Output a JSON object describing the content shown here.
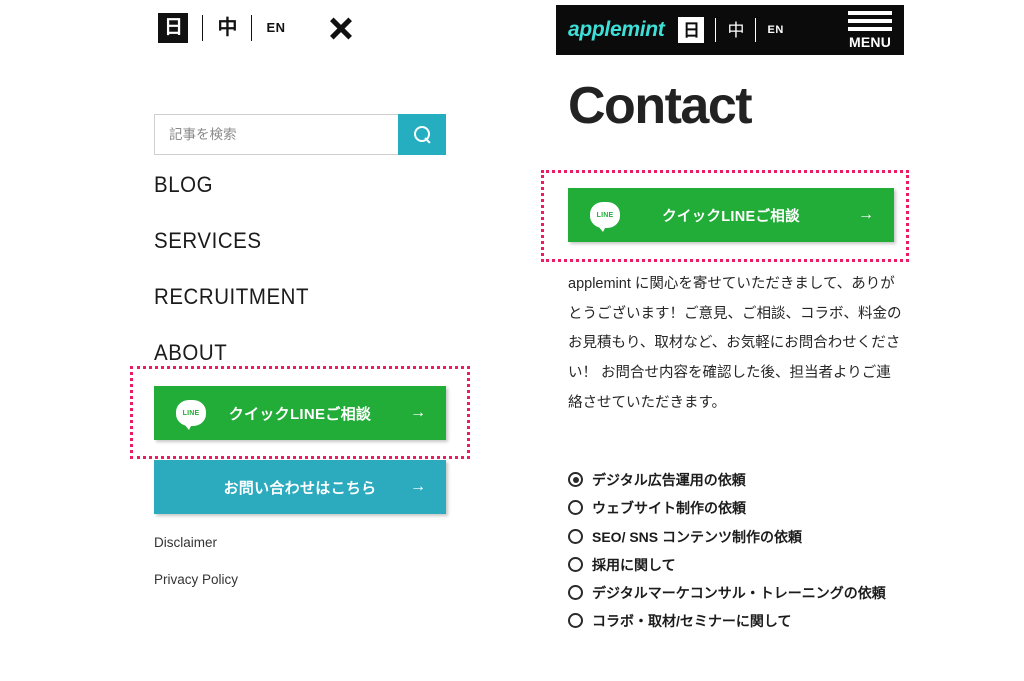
{
  "left_panel": {
    "header": {
      "lang_ja": "日",
      "lang_zh": "中",
      "lang_en": "EN",
      "close_icon": "close-icon"
    },
    "search": {
      "placeholder": "記事を検索",
      "value": "",
      "icon": "search-icon"
    },
    "nav": [
      {
        "label": "BLOG"
      },
      {
        "label": "SERVICES"
      },
      {
        "label": "RECRUITMENT"
      },
      {
        "label": "ABOUT"
      }
    ],
    "line_button": {
      "label": "クイックLINEご相談",
      "badge": "LINE",
      "arrow": "→",
      "color": "#22ac38"
    },
    "contact_button": {
      "label": "お問い合わせはこちら",
      "arrow": "→",
      "color": "#2cabbf"
    },
    "footer_links": [
      {
        "label": "Disclaimer"
      },
      {
        "label": "Privacy Policy"
      }
    ]
  },
  "right_panel": {
    "header": {
      "brand": "applemint",
      "lang_ja": "日",
      "lang_zh": "中",
      "lang_en": "EN",
      "menu_label": "MENU"
    },
    "title": "Contact",
    "line_button": {
      "label": "クイックLINEご相談",
      "badge": "LINE",
      "arrow": "→",
      "color": "#22ac38"
    },
    "body_paragraph": "applemint に関心を寄せていただきまして、ありがとうございます！ご意見、ご相談、コラボ、料金のお見積もり、取材など、お気軽にお問合わせください！\nお問合せ内容を確認した後、担当者よりご連絡させていただきます。",
    "radio_options": [
      {
        "label": "デジタル広告運用の依頼",
        "selected": true
      },
      {
        "label": "ウェブサイト制作の依頼",
        "selected": false
      },
      {
        "label": "SEO/ SNS コンテンツ制作の依頼",
        "selected": false
      },
      {
        "label": "採用に関して",
        "selected": false
      },
      {
        "label": "デジタルマーケコンサル・トレーニングの依頼",
        "selected": false
      },
      {
        "label": "コラボ・取材/セミナーに関して",
        "selected": false
      }
    ]
  },
  "annotations": {
    "color": "#ec1c62",
    "left_box": "line-button-highlight",
    "right_box": "line-button-highlight"
  }
}
